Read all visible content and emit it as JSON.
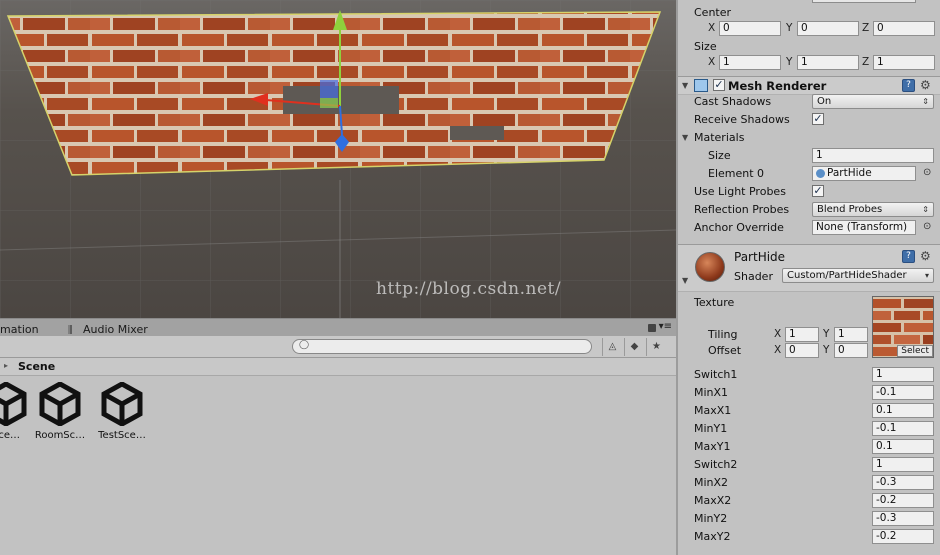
{
  "scene": {
    "watermark": "http://blog.csdn.net/"
  },
  "project": {
    "tabs": {
      "animation": "imation",
      "audio_mixer": "Audio Mixer"
    },
    "breadcrumb": "Scene",
    "assets": [
      {
        "label": "Sce…"
      },
      {
        "label": "RoomSc…"
      },
      {
        "label": "TestSce…"
      }
    ]
  },
  "inspector": {
    "box_collider": {
      "center_label": "Center",
      "center": {
        "x": "0",
        "y": "0",
        "z": "0"
      },
      "size_label": "Size",
      "size": {
        "x": "1",
        "y": "1",
        "z": "1"
      },
      "axis_x": "X",
      "axis_y": "Y",
      "axis_z": "Z"
    },
    "mesh_renderer": {
      "title": "Mesh Renderer",
      "cast_shadows_label": "Cast Shadows",
      "cast_shadows_value": "On",
      "receive_shadows_label": "Receive Shadows",
      "materials_label": "Materials",
      "size_label": "Size",
      "size_value": "1",
      "element0_label": "Element 0",
      "element0_value": "PartHide",
      "use_light_probes_label": "Use Light Probes",
      "reflection_probes_label": "Reflection Probes",
      "reflection_probes_value": "Blend Probes",
      "anchor_override_label": "Anchor Override",
      "anchor_override_value": "None (Transform)"
    },
    "material": {
      "name": "PartHide",
      "shader_label": "Shader",
      "shader_value": "Custom/PartHideShader",
      "texture_label": "Texture",
      "tiling_label": "Tiling",
      "offset_label": "Offset",
      "tiling": {
        "x": "1",
        "y": "1"
      },
      "offset": {
        "x": "0",
        "y": "0"
      },
      "select_label": "Select",
      "properties": [
        {
          "label": "Switch1",
          "value": "1"
        },
        {
          "label": "MinX1",
          "value": "-0.1"
        },
        {
          "label": "MaxX1",
          "value": "0.1"
        },
        {
          "label": "MinY1",
          "value": "-0.1"
        },
        {
          "label": "MaxY1",
          "value": "0.1"
        },
        {
          "label": "Switch2",
          "value": "1"
        },
        {
          "label": "MinX2",
          "value": "-0.3"
        },
        {
          "label": "MaxX2",
          "value": "-0.2"
        },
        {
          "label": "MinY2",
          "value": "-0.3"
        },
        {
          "label": "MaxY2",
          "value": "-0.2"
        }
      ]
    }
  },
  "colors": {
    "panel_bg": "#c2c2c2",
    "scene_bg": "#57524d",
    "brick": "#b5552e",
    "mortar": "#d8c6b0",
    "gizmo_y": "#8fd13c",
    "gizmo_x": "#e0301e",
    "gizmo_z": "#2f6fe0"
  }
}
